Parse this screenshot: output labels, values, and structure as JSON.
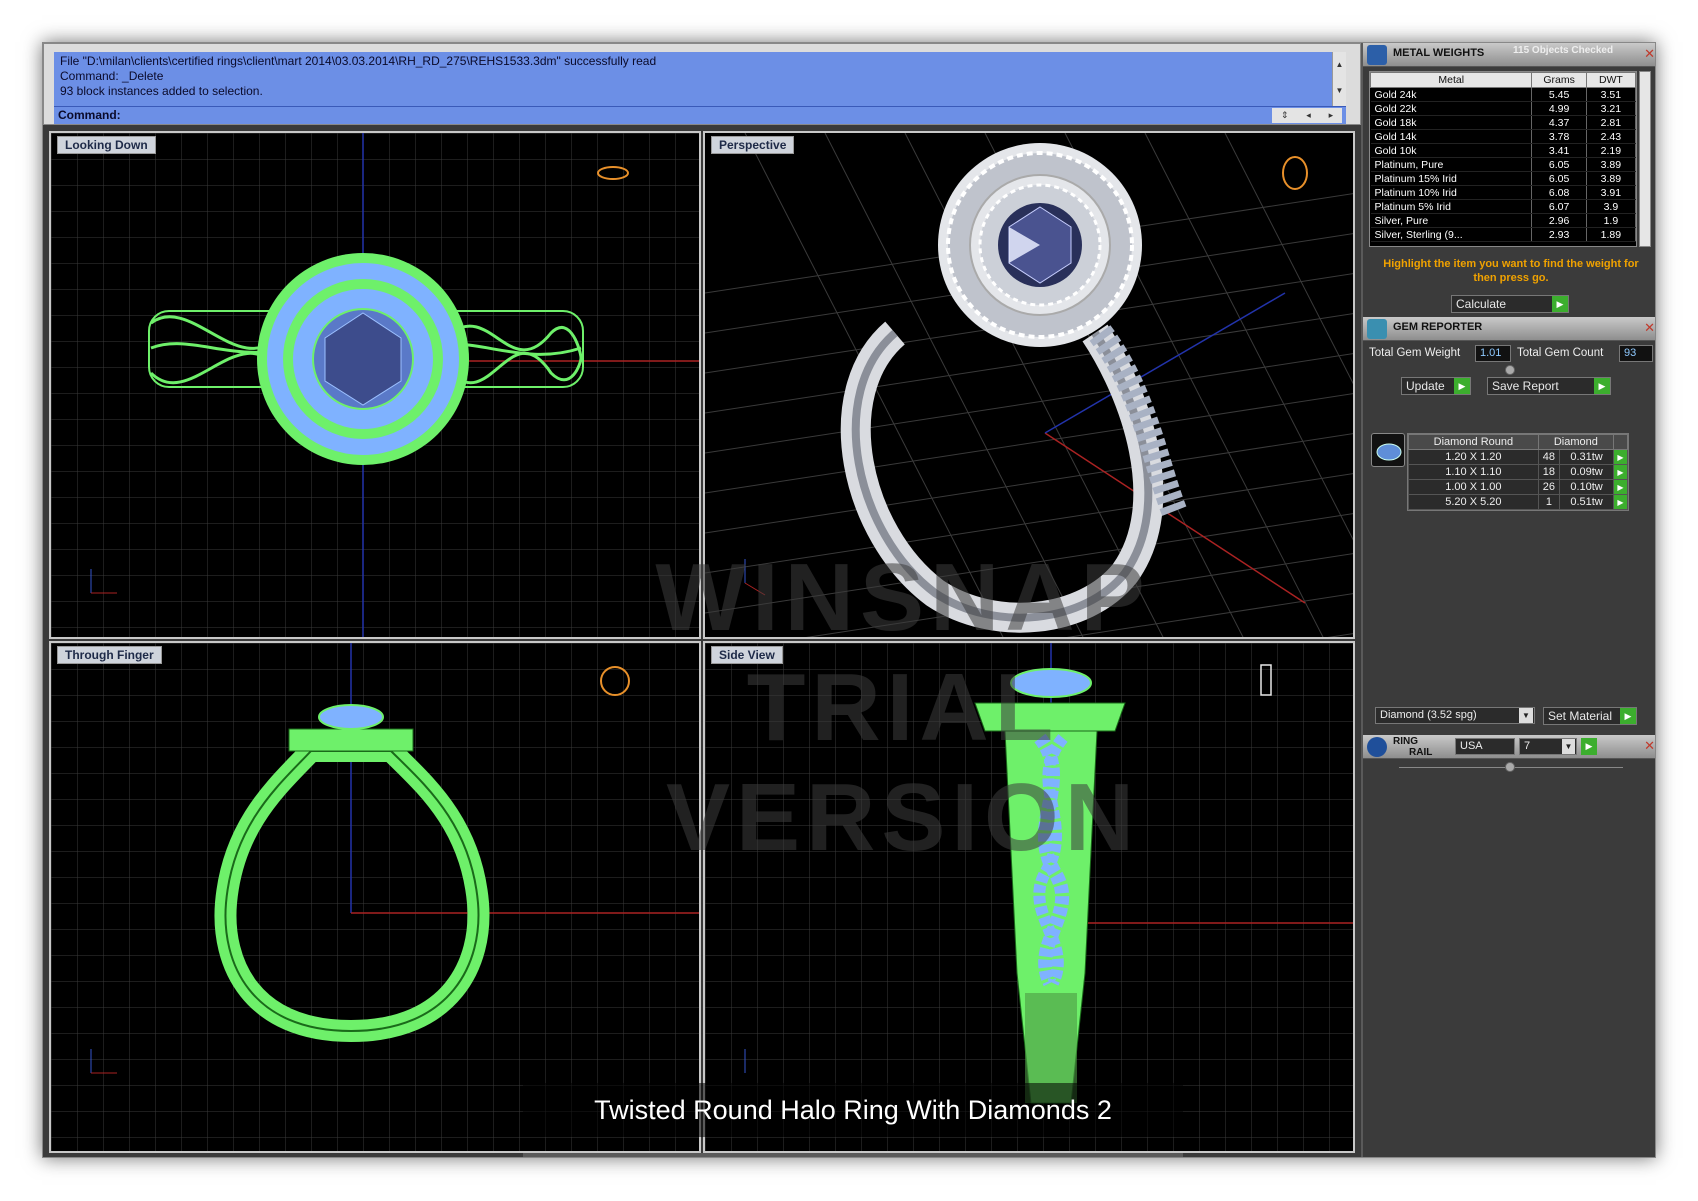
{
  "command": {
    "history": [
      "File \"D:\\milan\\clients\\certified rings\\client\\mart 2014\\03.03.2014\\RH_RD_275\\REHS1533.3dm\" successfully read",
      "Command: _Delete",
      "93 block instances added to selection."
    ],
    "prompt_label": "Command:",
    "input_value": ""
  },
  "viewports": {
    "top": "Looking Down",
    "perspective": "Perspective",
    "front": "Through Finger",
    "side": "Side View"
  },
  "watermark": {
    "line1": "WINSNAP",
    "line2": "TRIAL VERSION"
  },
  "caption": "Twisted Round Halo Ring With Diamonds 2",
  "metal_weights": {
    "title": "METAL WEIGHTS",
    "status": "115 Objects Checked",
    "columns": [
      "Metal",
      "Grams",
      "DWT"
    ],
    "rows": [
      [
        "Gold 24k",
        "5.45",
        "3.51"
      ],
      [
        "Gold 22k",
        "4.99",
        "3.21"
      ],
      [
        "Gold 18k",
        "4.37",
        "2.81"
      ],
      [
        "Gold 14k",
        "3.78",
        "2.43"
      ],
      [
        "Gold 10k",
        "3.41",
        "2.19"
      ],
      [
        "Platinum, Pure",
        "6.05",
        "3.89"
      ],
      [
        "Platinum 15% Irid",
        "6.05",
        "3.89"
      ],
      [
        "Platinum 10% Irid",
        "6.08",
        "3.91"
      ],
      [
        "Platinum 5% Irid",
        "6.07",
        "3.9"
      ],
      [
        "Silver, Pure",
        "2.96",
        "1.9"
      ],
      [
        "Silver, Sterling (9...",
        "2.93",
        "1.89"
      ]
    ],
    "hint": "Highlight the item you want to find the weight for then press go.",
    "calculate_label": "Calculate"
  },
  "gem_reporter": {
    "title": "GEM REPORTER",
    "total_weight_label": "Total Gem Weight",
    "total_weight_value": "1.01",
    "total_count_label": "Total Gem Count",
    "total_count_value": "93",
    "update_label": "Update",
    "save_label": "Save Report",
    "columns": [
      "Diamond Round",
      "Diamond"
    ],
    "rows": [
      [
        "1.20 X 1.20",
        "48",
        "0.31tw"
      ],
      [
        "1.10 X 1.10",
        "18",
        "0.09tw"
      ],
      [
        "1.00 X 1.00",
        "26",
        "0.10tw"
      ],
      [
        "5.20 X 5.20",
        "1",
        "0.51tw"
      ]
    ],
    "material_value": "Diamond   (3.52 spg)",
    "set_material_label": "Set Material"
  },
  "ring_rail": {
    "title_line1": "RING",
    "title_line2": "RAIL",
    "country": "USA",
    "size": "7"
  },
  "colors": {
    "wire_green": "#6ef06a",
    "gem_blue": "#7fb2ff",
    "grid": "#3d3d3d",
    "cmd_bg": "#6c8fe6",
    "hint": "#f0a200",
    "go_green": "#3cae2e"
  }
}
